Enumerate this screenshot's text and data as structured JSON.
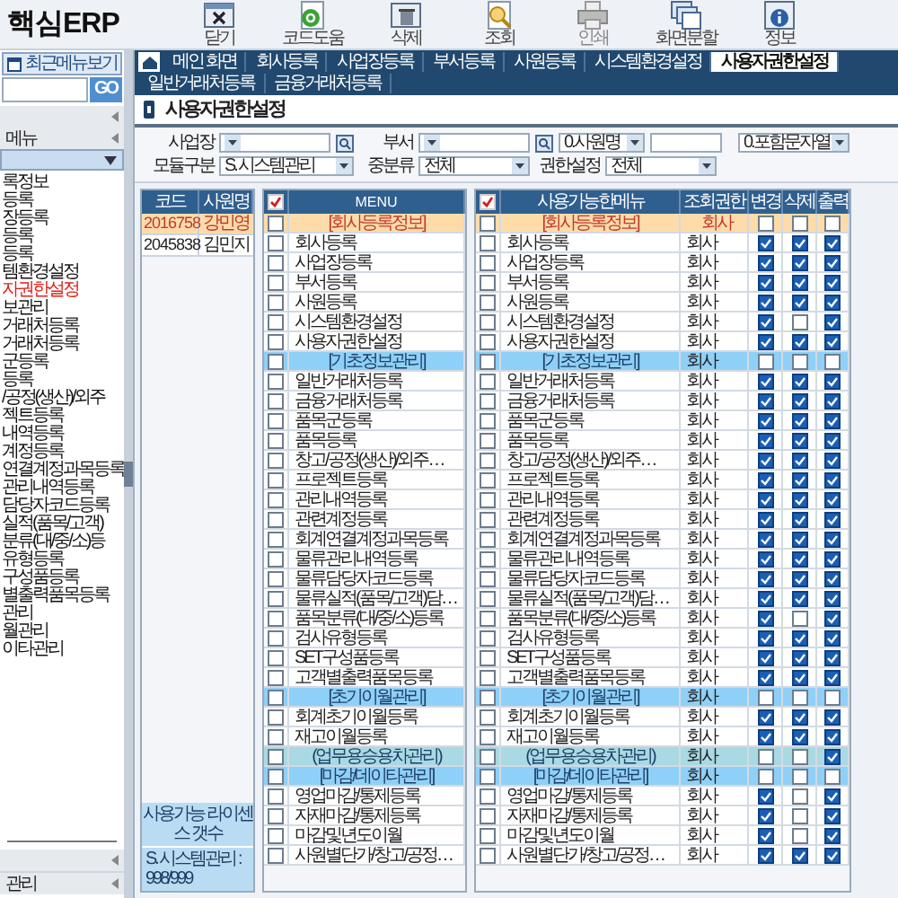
{
  "app": {
    "logo": "핵심ERP"
  },
  "toolbar": [
    {
      "label": "닫기",
      "kind": "close",
      "disabled": false
    },
    {
      "label": "코드도움",
      "kind": "help",
      "disabled": false
    },
    {
      "label": "삭제",
      "kind": "delete",
      "disabled": false
    },
    {
      "label": "조회",
      "kind": "search",
      "disabled": false
    },
    {
      "label": "인쇄",
      "kind": "print",
      "disabled": true
    },
    {
      "label": "화면분할",
      "kind": "split",
      "disabled": false
    },
    {
      "label": "정보",
      "kind": "info",
      "disabled": false
    }
  ],
  "sidebar": {
    "recent_button": "최근메뉴보기",
    "search_button": "GO",
    "menu_label": "메뉴",
    "items": [
      {
        "label": "록정보",
        "selected": false
      },
      {
        "label": "등록",
        "selected": false
      },
      {
        "label": "장등록",
        "selected": false
      },
      {
        "label": "등록",
        "selected": false
      },
      {
        "label": "등록",
        "selected": false
      },
      {
        "label": "템환경설정",
        "selected": false
      },
      {
        "label": "자권한설정",
        "selected": true
      },
      {
        "label": "보관리",
        "selected": false
      },
      {
        "label": "거래처등록",
        "selected": false
      },
      {
        "label": "거래처등록",
        "selected": false
      },
      {
        "label": "군등록",
        "selected": false
      },
      {
        "label": "등록",
        "selected": false
      },
      {
        "label": "/공정(생산)/외주",
        "selected": false
      },
      {
        "label": "젝트등록",
        "selected": false
      },
      {
        "label": "내역등록",
        "selected": false
      },
      {
        "label": "계정등록",
        "selected": false
      },
      {
        "label": "연결계정과목등록",
        "selected": false
      },
      {
        "label": "관리내역등록",
        "selected": false
      },
      {
        "label": "담당자코드등록",
        "selected": false
      },
      {
        "label": "실적(품목/고객)",
        "selected": false
      },
      {
        "label": "분류(대/중/소)등",
        "selected": false
      },
      {
        "label": "유형등록",
        "selected": false
      },
      {
        "label": "구성품등록",
        "selected": false
      },
      {
        "label": "별출력품목등록",
        "selected": false
      },
      {
        "label": "관리",
        "selected": false
      },
      {
        "label": "월관리",
        "selected": false
      },
      {
        "label": "이타관리",
        "selected": false
      }
    ],
    "bottom_label": "관리"
  },
  "tabs": [
    {
      "label": "메인 화면",
      "selected": false
    },
    {
      "label": "회사등록",
      "selected": false
    },
    {
      "label": "사업장등록",
      "selected": false
    },
    {
      "label": "부서등록",
      "selected": false
    },
    {
      "label": "사원등록",
      "selected": false
    },
    {
      "label": "시스템환경설정",
      "selected": false
    },
    {
      "label": "사용자권한설정",
      "selected": true
    },
    {
      "label": "일반거래처등록",
      "selected": false
    },
    {
      "label": "금융거래처등록",
      "selected": false
    }
  ],
  "page_title": "사용자권한설정",
  "filters": {
    "business_site": {
      "label": "사업장"
    },
    "department": {
      "label": "부서"
    },
    "search_type": {
      "value": "0.사원명"
    },
    "match_mode": {
      "value": "0.포함문자열"
    },
    "module": {
      "label": "모듈구분",
      "value": "S. 시스템관리"
    },
    "middle_category": {
      "label": "중분류",
      "value": "전체"
    },
    "permission": {
      "label": "권한설정",
      "value": "전체"
    }
  },
  "employees": {
    "columns": [
      "코드",
      "사원명"
    ],
    "rows": [
      {
        "code": "2016758",
        "name": "강민영",
        "selected": true
      },
      {
        "code": "2045838",
        "name": "김민지",
        "selected": false
      }
    ],
    "license_label": "사용가능 라이센스 갯수",
    "license_value": "S. 시스템관리 : 998/999"
  },
  "menu_table": {
    "header": "MENU",
    "rows": [
      {
        "label": "[회사등록정보]",
        "kind": "group",
        "color": "#fddcaa",
        "checked": false
      },
      {
        "label": "회사등록",
        "kind": "item",
        "checked": false
      },
      {
        "label": "사업장등록",
        "kind": "item",
        "checked": false
      },
      {
        "label": "부서등록",
        "kind": "item",
        "checked": false
      },
      {
        "label": "사원등록",
        "kind": "item",
        "checked": false
      },
      {
        "label": "시스템환경설정",
        "kind": "item",
        "checked": false
      },
      {
        "label": "사용자권한설정",
        "kind": "item",
        "checked": false
      },
      {
        "label": "[기초정보관리]",
        "kind": "group",
        "color": "#8fd0f8",
        "checked": false
      },
      {
        "label": "일반거래처등록",
        "kind": "item",
        "checked": false
      },
      {
        "label": "금융거래처등록",
        "kind": "item",
        "checked": false
      },
      {
        "label": "품목군등록",
        "kind": "item",
        "checked": false
      },
      {
        "label": "품목등록",
        "kind": "item",
        "checked": false
      },
      {
        "label": "창고/공정(생산)/외주…",
        "kind": "item",
        "checked": false
      },
      {
        "label": "프로젝트등록",
        "kind": "item",
        "checked": false
      },
      {
        "label": "관리내역등록",
        "kind": "item",
        "checked": false
      },
      {
        "label": "관련계정등록",
        "kind": "item",
        "checked": false
      },
      {
        "label": "회계연결계정과목등록",
        "kind": "item",
        "checked": false
      },
      {
        "label": "물류관리내역등록",
        "kind": "item",
        "checked": false
      },
      {
        "label": "물류담당자코드등록",
        "kind": "item",
        "checked": false
      },
      {
        "label": "물류실적(품목/고객)담…",
        "kind": "item",
        "checked": false
      },
      {
        "label": "품목분류(대/중/소)등록",
        "kind": "item",
        "checked": false
      },
      {
        "label": "검사유형등록",
        "kind": "item",
        "checked": false
      },
      {
        "label": "SET구성품등록",
        "kind": "item",
        "checked": false
      },
      {
        "label": "고객별출력품목등록",
        "kind": "item",
        "checked": false
      },
      {
        "label": "[초기이월관리]",
        "kind": "group",
        "color": "#8fd0f8",
        "checked": false
      },
      {
        "label": "회계초기이월등록",
        "kind": "item",
        "checked": false
      },
      {
        "label": "재고이월등록",
        "kind": "item",
        "checked": false
      },
      {
        "label": "(업무용승용차관리)",
        "kind": "group",
        "color": "#a9d9e3",
        "checked": false
      },
      {
        "label": "[마감/데이타관리]",
        "kind": "group",
        "color": "#8fd0f8",
        "checked": false
      },
      {
        "label": "영업마감/통제등록",
        "kind": "item",
        "checked": false
      },
      {
        "label": "자재마감/통제등록",
        "kind": "item",
        "checked": false
      },
      {
        "label": "마감및년도이월",
        "kind": "item",
        "checked": false
      },
      {
        "label": "사원별단가/창고/공정…",
        "kind": "item",
        "checked": false
      }
    ]
  },
  "permission_table": {
    "columns": [
      "사용가능한메뉴",
      "조회권한",
      "변경",
      "삭제",
      "출력"
    ],
    "rows": [
      {
        "label": "[회사등록정보]",
        "kind": "group",
        "color": "#fddcaa",
        "checked": false,
        "scope": "회사",
        "edit": false,
        "delete": false,
        "print": false
      },
      {
        "label": "회사등록",
        "kind": "item",
        "checked": false,
        "scope": "회사",
        "edit": true,
        "delete": true,
        "print": true
      },
      {
        "label": "사업장등록",
        "kind": "item",
        "checked": false,
        "scope": "회사",
        "edit": true,
        "delete": true,
        "print": true
      },
      {
        "label": "부서등록",
        "kind": "item",
        "checked": false,
        "scope": "회사",
        "edit": true,
        "delete": true,
        "print": true
      },
      {
        "label": "사원등록",
        "kind": "item",
        "checked": false,
        "scope": "회사",
        "edit": true,
        "delete": true,
        "print": true
      },
      {
        "label": "시스템환경설정",
        "kind": "item",
        "checked": false,
        "scope": "회사",
        "edit": true,
        "delete": false,
        "print": true
      },
      {
        "label": "사용자권한설정",
        "kind": "item",
        "checked": false,
        "scope": "회사",
        "edit": true,
        "delete": true,
        "print": true
      },
      {
        "label": "[기초정보관리]",
        "kind": "group",
        "color": "#8fd0f8",
        "checked": false,
        "scope": "회사",
        "edit": false,
        "delete": false,
        "print": false
      },
      {
        "label": "일반거래처등록",
        "kind": "item",
        "checked": false,
        "scope": "회사",
        "edit": true,
        "delete": true,
        "print": true
      },
      {
        "label": "금융거래처등록",
        "kind": "item",
        "checked": false,
        "scope": "회사",
        "edit": true,
        "delete": true,
        "print": true
      },
      {
        "label": "품목군등록",
        "kind": "item",
        "checked": false,
        "scope": "회사",
        "edit": true,
        "delete": true,
        "print": true
      },
      {
        "label": "품목등록",
        "kind": "item",
        "checked": false,
        "scope": "회사",
        "edit": true,
        "delete": true,
        "print": true
      },
      {
        "label": "창고/공정(생산)/외주…",
        "kind": "item",
        "checked": false,
        "scope": "회사",
        "edit": true,
        "delete": true,
        "print": true
      },
      {
        "label": "프로젝트등록",
        "kind": "item",
        "checked": false,
        "scope": "회사",
        "edit": true,
        "delete": true,
        "print": true
      },
      {
        "label": "관리내역등록",
        "kind": "item",
        "checked": false,
        "scope": "회사",
        "edit": true,
        "delete": true,
        "print": true
      },
      {
        "label": "관련계정등록",
        "kind": "item",
        "checked": false,
        "scope": "회사",
        "edit": true,
        "delete": true,
        "print": true
      },
      {
        "label": "회계연결계정과목등록",
        "kind": "item",
        "checked": false,
        "scope": "회사",
        "edit": true,
        "delete": true,
        "print": true
      },
      {
        "label": "물류관리내역등록",
        "kind": "item",
        "checked": false,
        "scope": "회사",
        "edit": true,
        "delete": true,
        "print": true
      },
      {
        "label": "물류담당자코드등록",
        "kind": "item",
        "checked": false,
        "scope": "회사",
        "edit": true,
        "delete": true,
        "print": true
      },
      {
        "label": "물류실적(품목/고객)담…",
        "kind": "item",
        "checked": false,
        "scope": "회사",
        "edit": true,
        "delete": true,
        "print": true
      },
      {
        "label": "품목분류(대/중/소)등록",
        "kind": "item",
        "checked": false,
        "scope": "회사",
        "edit": true,
        "delete": false,
        "print": true
      },
      {
        "label": "검사유형등록",
        "kind": "item",
        "checked": false,
        "scope": "회사",
        "edit": true,
        "delete": true,
        "print": true
      },
      {
        "label": "SET구성품등록",
        "kind": "item",
        "checked": false,
        "scope": "회사",
        "edit": true,
        "delete": true,
        "print": true
      },
      {
        "label": "고객별출력품목등록",
        "kind": "item",
        "checked": false,
        "scope": "회사",
        "edit": true,
        "delete": true,
        "print": true
      },
      {
        "label": "[초기이월관리]",
        "kind": "group",
        "color": "#8fd0f8",
        "checked": false,
        "scope": "회사",
        "edit": false,
        "delete": false,
        "print": false
      },
      {
        "label": "회계초기이월등록",
        "kind": "item",
        "checked": false,
        "scope": "회사",
        "edit": true,
        "delete": true,
        "print": true
      },
      {
        "label": "재고이월등록",
        "kind": "item",
        "checked": false,
        "scope": "회사",
        "edit": true,
        "delete": true,
        "print": true
      },
      {
        "label": "(업무용승용차관리)",
        "kind": "group",
        "color": "#a9d9e3",
        "checked": false,
        "scope": "회사",
        "edit": false,
        "delete": false,
        "print": true
      },
      {
        "label": "[마감/데이타관리]",
        "kind": "group",
        "color": "#8fd0f8",
        "checked": false,
        "scope": "회사",
        "edit": false,
        "delete": false,
        "print": false
      },
      {
        "label": "영업마감/통제등록",
        "kind": "item",
        "checked": false,
        "scope": "회사",
        "edit": true,
        "delete": false,
        "print": true
      },
      {
        "label": "자재마감/통제등록",
        "kind": "item",
        "checked": false,
        "scope": "회사",
        "edit": true,
        "delete": false,
        "print": true
      },
      {
        "label": "마감및년도이월",
        "kind": "item",
        "checked": false,
        "scope": "회사",
        "edit": true,
        "delete": false,
        "print": true
      },
      {
        "label": "사원별단가/창고/공정…",
        "kind": "item",
        "checked": false,
        "scope": "회사",
        "edit": true,
        "delete": true,
        "print": true
      }
    ]
  }
}
